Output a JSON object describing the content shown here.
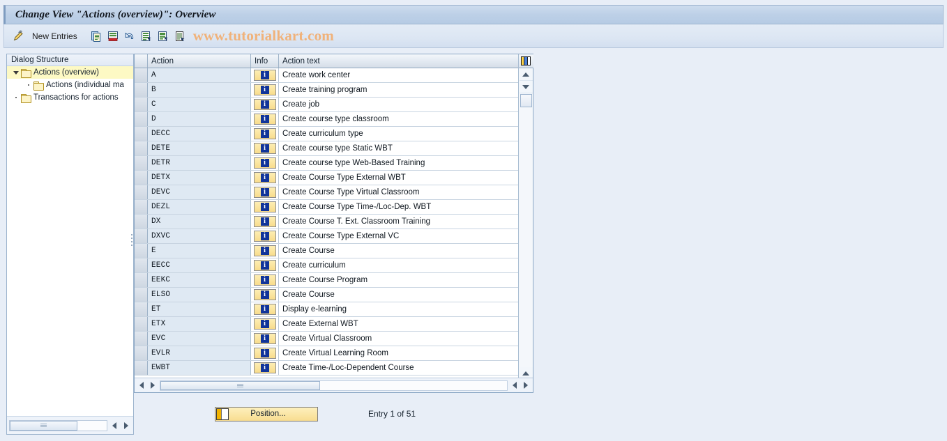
{
  "window": {
    "title": "Change View \"Actions (overview)\": Overview"
  },
  "toolbar": {
    "change_icon": "pencil-icon",
    "new_entries_label": "New Entries",
    "buttons": [
      {
        "name": "copy-as-icon",
        "icon": "copy-icon"
      },
      {
        "name": "delete-icon",
        "icon": "delete-row-icon"
      },
      {
        "name": "undo-icon",
        "icon": "undo-arrow-icon"
      },
      {
        "name": "select-all-icon",
        "icon": "select-all-icon"
      },
      {
        "name": "deselect-all-icon",
        "icon": "deselect-all-icon"
      },
      {
        "name": "details-icon",
        "icon": "details-icon"
      }
    ],
    "watermark": "www.tutorialkart.com"
  },
  "sidebar": {
    "header": "Dialog Structure",
    "items": [
      {
        "label": "Actions (overview)",
        "level": 0,
        "expanded": true,
        "selected": true,
        "marker": "arrow"
      },
      {
        "label": "Actions (individual ma",
        "level": 1,
        "expanded": false,
        "selected": false,
        "marker": "dot"
      },
      {
        "label": "Transactions for actions",
        "level": 0,
        "expanded": false,
        "selected": false,
        "marker": "dot"
      }
    ],
    "hscroll": {
      "left_arrow": "◄",
      "right_arrow": "►"
    }
  },
  "table": {
    "columns": [
      "",
      "Action",
      "Info",
      "Action text"
    ],
    "info_glyph": "i",
    "config_icon": "column-config-icon",
    "rows": [
      {
        "action": "A",
        "text": "Create work center"
      },
      {
        "action": "B",
        "text": "Create training program"
      },
      {
        "action": "C",
        "text": "Create job"
      },
      {
        "action": "D",
        "text": "Create course type classroom"
      },
      {
        "action": "DECC",
        "text": "Create curriculum type"
      },
      {
        "action": "DETE",
        "text": "Create course type Static WBT"
      },
      {
        "action": "DETR",
        "text": "Create course type Web-Based Training"
      },
      {
        "action": "DETX",
        "text": "Create Course Type External WBT"
      },
      {
        "action": "DEVC",
        "text": "Create Course Type Virtual Classroom"
      },
      {
        "action": "DEZL",
        "text": "Create Course Type Time-/Loc-Dep. WBT"
      },
      {
        "action": "DX",
        "text": "Create Course T. Ext. Classroom Training"
      },
      {
        "action": "DXVC",
        "text": "Create Course Type External VC"
      },
      {
        "action": "E",
        "text": "Create Course"
      },
      {
        "action": "EECC",
        "text": "Create curriculum"
      },
      {
        "action": "EEKC",
        "text": "Create Course Program"
      },
      {
        "action": "ELSO",
        "text": "Create Course"
      },
      {
        "action": "ET",
        "text": "Display e-learning"
      },
      {
        "action": "ETX",
        "text": "Create External WBT"
      },
      {
        "action": "EVC",
        "text": "Create Virtual Classroom"
      },
      {
        "action": "EVLR",
        "text": "Create Virtual Learning Room"
      },
      {
        "action": "EWBT",
        "text": "Create Time-/Loc-Dependent Course"
      }
    ]
  },
  "footer": {
    "position_label": "Position...",
    "entry_status": "Entry 1 of 51"
  },
  "colors": {
    "title_bar": "#bdd0e7",
    "window_bg": "#e8eef7",
    "selection": "#fdf9c4",
    "action_cell": "#dfe9f3",
    "info_button": "#f8dc8c",
    "watermark": "#f0b27a"
  }
}
